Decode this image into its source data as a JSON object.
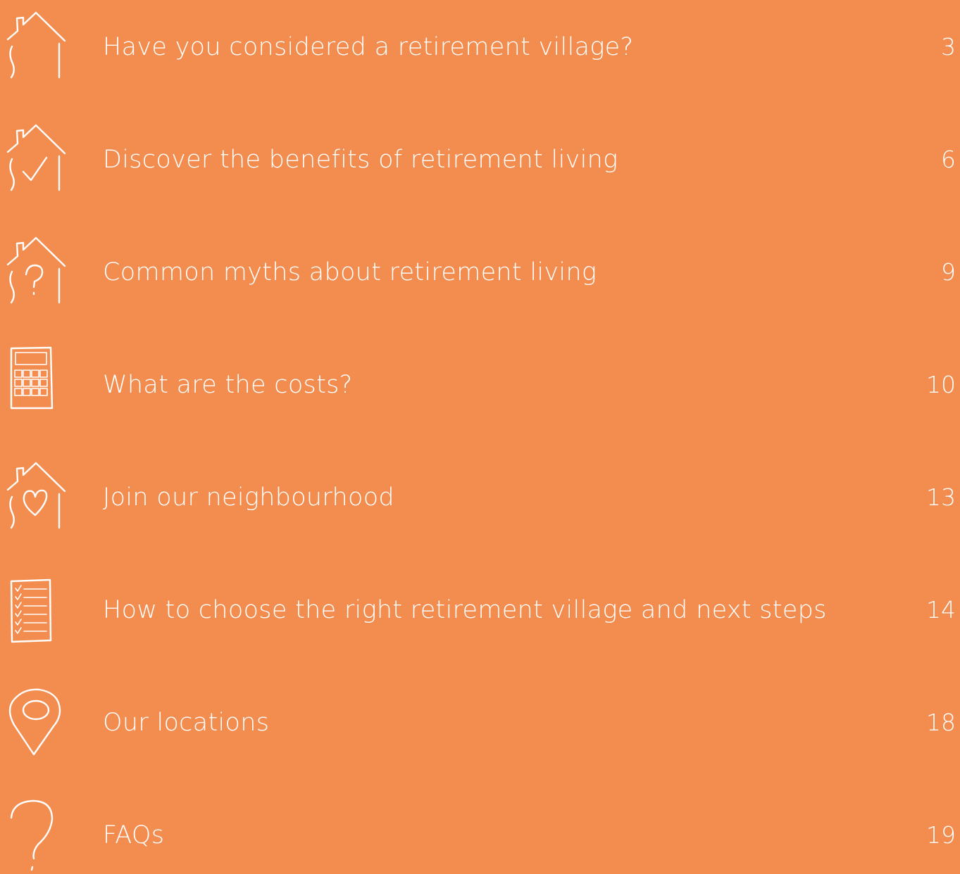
{
  "items": [
    {
      "title": "Have you considered a retirement village?",
      "page": "3",
      "icon": "house-icon"
    },
    {
      "title": "Discover the benefits of retirement living",
      "page": "6",
      "icon": "house-checkmark-icon"
    },
    {
      "title": "Common myths about retirement living",
      "page": "9",
      "icon": "house-question-icon"
    },
    {
      "title": "What are the costs?",
      "page": "10",
      "icon": "calculator-icon"
    },
    {
      "title": "Join our neighbourhood",
      "page": "13",
      "icon": "house-heart-icon"
    },
    {
      "title": "How to choose the right retirement village and next steps",
      "page": "14",
      "icon": "checklist-icon"
    },
    {
      "title": "Our locations",
      "page": "18",
      "icon": "location-pin-icon"
    },
    {
      "title": "FAQs",
      "page": "19",
      "icon": "question-mark-icon"
    }
  ],
  "colors": {
    "background": "#F38D4F",
    "text": "#FFFFFF"
  }
}
